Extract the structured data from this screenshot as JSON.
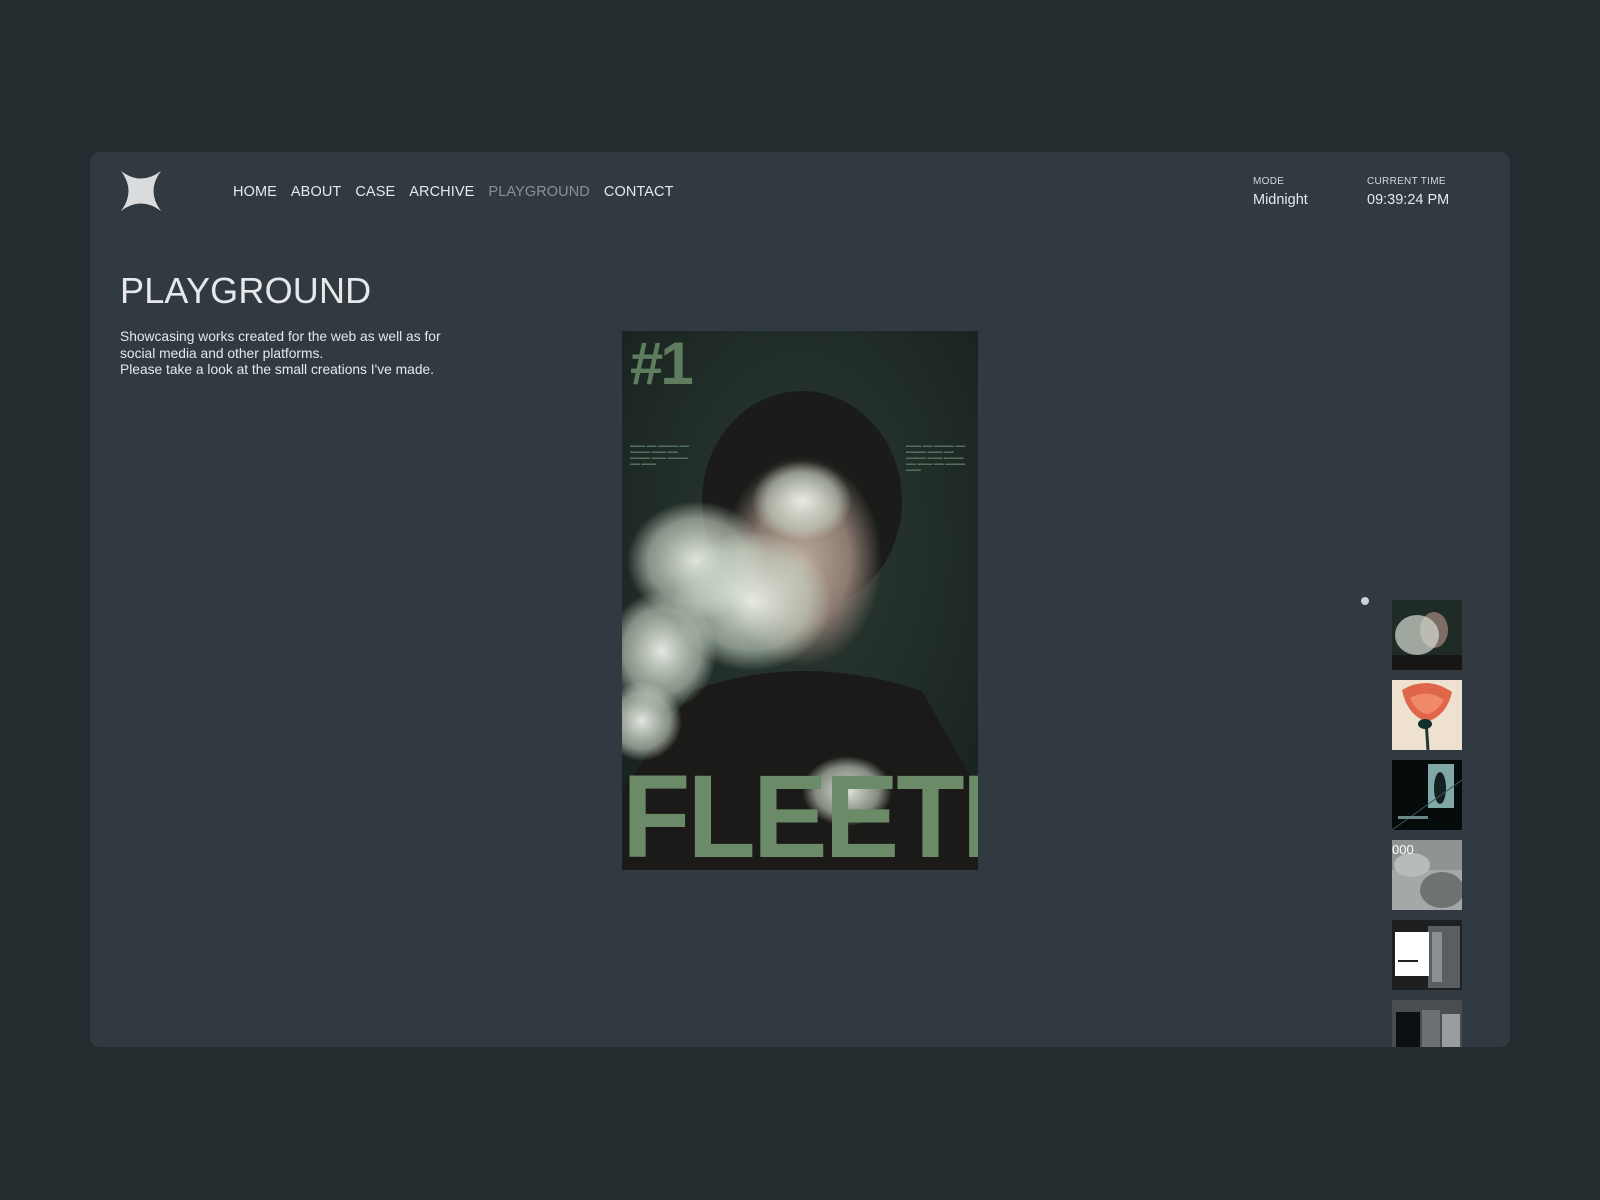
{
  "nav": {
    "items": [
      {
        "label": "HOME",
        "active": false
      },
      {
        "label": "ABOUT",
        "active": false
      },
      {
        "label": "CASE",
        "active": false
      },
      {
        "label": "ARCHIVE",
        "active": false
      },
      {
        "label": "PLAYGROUND",
        "active": true
      },
      {
        "label": "CONTACT",
        "active": false
      }
    ]
  },
  "mode": {
    "label": "MODE",
    "value": "Midnight"
  },
  "time": {
    "label": "CURRENT TIME",
    "value": "09:39:24 PM"
  },
  "page": {
    "title": "PLAYGROUND",
    "description": [
      "Showcasing works created for the web as well as for social media and other platforms.",
      "Please take a look at the small creations I've made."
    ]
  },
  "featured": {
    "number": "#1",
    "title": "FLEETING"
  },
  "thumbnails": [
    {
      "name": "thumb-fleeting",
      "theme": "woman-flowers"
    },
    {
      "name": "thumb-orange-flower",
      "theme": "flower"
    },
    {
      "name": "thumb-window-silhouette",
      "theme": "silhouette"
    },
    {
      "name": "thumb-grain-texture",
      "theme": "texture",
      "text": "000"
    },
    {
      "name": "thumb-white-panel",
      "theme": "panel"
    },
    {
      "name": "thumb-dark-collage",
      "theme": "collage"
    }
  ],
  "colors": {
    "background": "#252c30",
    "panel": "#323a41",
    "text": "#e6e8ea",
    "muted": "#8a9097",
    "poster_green": "#6a8a68"
  },
  "icons": {
    "logo": "four-point-star-icon",
    "pager": "dot-indicator-icon"
  }
}
